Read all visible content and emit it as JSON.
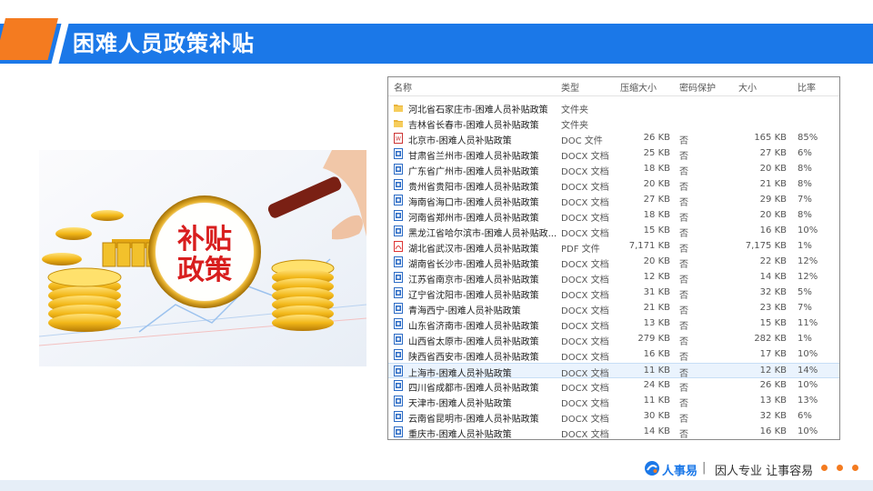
{
  "header": {
    "title": "困难人员政策补贴"
  },
  "photo": {
    "badge_line1": "补贴",
    "badge_line2": "政策"
  },
  "explorer": {
    "columns": {
      "name": "名称",
      "type": "类型",
      "compressed": "压缩大小",
      "password": "密码保护",
      "size": "大小",
      "ratio": "比率"
    },
    "rows": [
      {
        "icon": "folder-icon",
        "name": "河北省石家庄市-困难人员补贴政策",
        "type": "文件夹",
        "compressed": "",
        "password": "",
        "size": "",
        "ratio": ""
      },
      {
        "icon": "folder-icon",
        "name": "吉林省长春市-困难人员补贴政策",
        "type": "文件夹",
        "compressed": "",
        "password": "",
        "size": "",
        "ratio": ""
      },
      {
        "icon": "doc-icon",
        "name": "北京市-困难人员补贴政策",
        "type": "DOC 文件",
        "compressed": "26 KB",
        "password": "否",
        "size": "165 KB",
        "ratio": "85%"
      },
      {
        "icon": "docx-icon",
        "name": "甘肃省兰州市-困难人员补贴政策",
        "type": "DOCX 文档",
        "compressed": "25 KB",
        "password": "否",
        "size": "27 KB",
        "ratio": "6%"
      },
      {
        "icon": "docx-icon",
        "name": "广东省广州市-困难人员补贴政策",
        "type": "DOCX 文档",
        "compressed": "18 KB",
        "password": "否",
        "size": "20 KB",
        "ratio": "8%"
      },
      {
        "icon": "docx-icon",
        "name": "贵州省贵阳市-困难人员补贴政策",
        "type": "DOCX 文档",
        "compressed": "20 KB",
        "password": "否",
        "size": "21 KB",
        "ratio": "8%"
      },
      {
        "icon": "docx-icon",
        "name": "海南省海口市-困难人员补贴政策",
        "type": "DOCX 文档",
        "compressed": "27 KB",
        "password": "否",
        "size": "29 KB",
        "ratio": "7%"
      },
      {
        "icon": "docx-icon",
        "name": "河南省郑州市-困难人员补贴政策",
        "type": "DOCX 文档",
        "compressed": "18 KB",
        "password": "否",
        "size": "20 KB",
        "ratio": "8%"
      },
      {
        "icon": "docx-icon",
        "name": "黑龙江省哈尔滨市-困难人员补贴政...",
        "type": "DOCX 文档",
        "compressed": "15 KB",
        "password": "否",
        "size": "16 KB",
        "ratio": "10%"
      },
      {
        "icon": "pdf-icon",
        "name": "湖北省武汉市-困难人员补贴政策",
        "type": "PDF 文件",
        "compressed": "7,171 KB",
        "password": "否",
        "size": "7,175 KB",
        "ratio": "1%"
      },
      {
        "icon": "docx-icon",
        "name": "湖南省长沙市-困难人员补贴政策",
        "type": "DOCX 文档",
        "compressed": "20 KB",
        "password": "否",
        "size": "22 KB",
        "ratio": "12%"
      },
      {
        "icon": "docx-icon",
        "name": "江苏省南京市-困难人员补贴政策",
        "type": "DOCX 文档",
        "compressed": "12 KB",
        "password": "否",
        "size": "14 KB",
        "ratio": "12%"
      },
      {
        "icon": "docx-icon",
        "name": "辽宁省沈阳市-困难人员补贴政策",
        "type": "DOCX 文档",
        "compressed": "31 KB",
        "password": "否",
        "size": "32 KB",
        "ratio": "5%"
      },
      {
        "icon": "docx-icon",
        "name": "青海西宁-困难人员补贴政策",
        "type": "DOCX 文档",
        "compressed": "21 KB",
        "password": "否",
        "size": "23 KB",
        "ratio": "7%"
      },
      {
        "icon": "docx-icon",
        "name": "山东省济南市-困难人员补贴政策",
        "type": "DOCX 文档",
        "compressed": "13 KB",
        "password": "否",
        "size": "15 KB",
        "ratio": "11%"
      },
      {
        "icon": "docx-icon",
        "name": "山西省太原市-困难人员补贴政策",
        "type": "DOCX 文档",
        "compressed": "279 KB",
        "password": "否",
        "size": "282 KB",
        "ratio": "1%"
      },
      {
        "icon": "docx-icon",
        "name": "陕西省西安市-困难人员补贴政策",
        "type": "DOCX 文档",
        "compressed": "16 KB",
        "password": "否",
        "size": "17 KB",
        "ratio": "10%"
      },
      {
        "icon": "docx-icon",
        "name": "上海市-困难人员补贴政策",
        "type": "DOCX 文档",
        "compressed": "11 KB",
        "password": "否",
        "size": "12 KB",
        "ratio": "14%",
        "selected": true
      },
      {
        "icon": "docx-icon",
        "name": "四川省成都市-困难人员补贴政策",
        "type": "DOCX 文档",
        "compressed": "24 KB",
        "password": "否",
        "size": "26 KB",
        "ratio": "10%"
      },
      {
        "icon": "docx-icon",
        "name": "天津市-困难人员补贴政策",
        "type": "DOCX 文档",
        "compressed": "11 KB",
        "password": "否",
        "size": "13 KB",
        "ratio": "13%"
      },
      {
        "icon": "docx-icon",
        "name": "云南省昆明市-困难人员补贴政策",
        "type": "DOCX 文档",
        "compressed": "30 KB",
        "password": "否",
        "size": "32 KB",
        "ratio": "6%"
      },
      {
        "icon": "docx-icon",
        "name": "重庆市-困难人员补贴政策",
        "type": "DOCX 文档",
        "compressed": "14 KB",
        "password": "否",
        "size": "16 KB",
        "ratio": "10%"
      }
    ]
  },
  "footer": {
    "brand_name": "人事易",
    "separator": "|",
    "slogan": "因人专业 让事容易"
  },
  "colors": {
    "accent": "#1b78e8",
    "orange": "#f47b20"
  }
}
